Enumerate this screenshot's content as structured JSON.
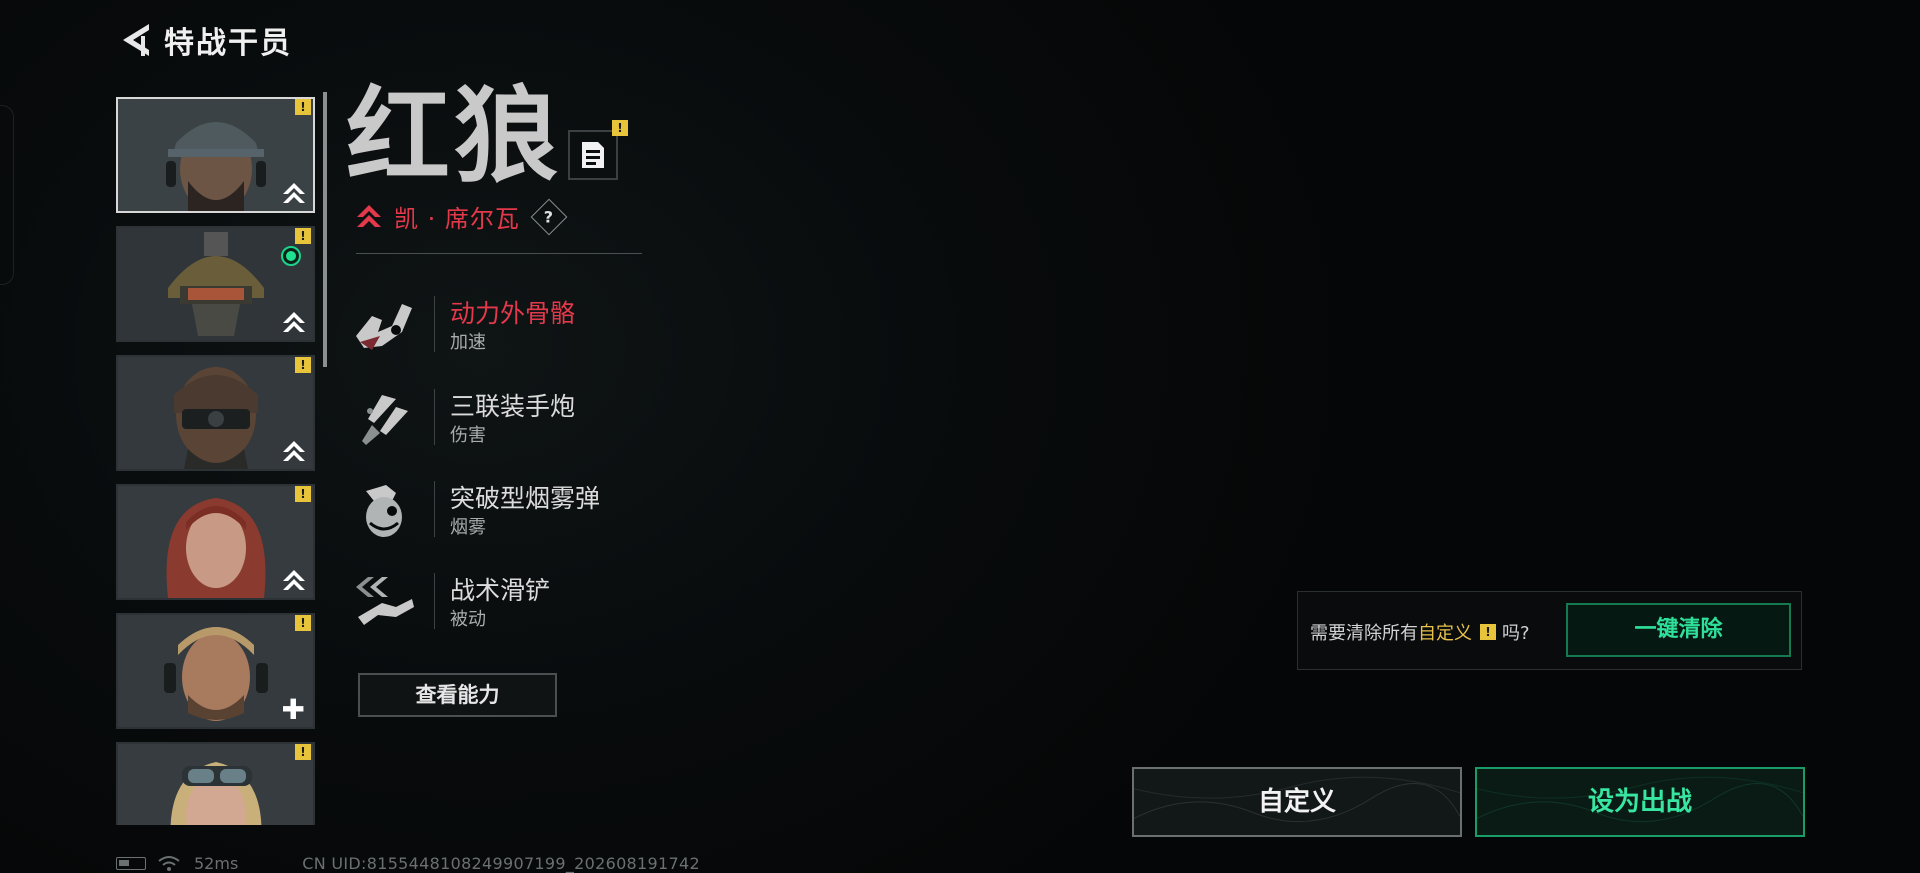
{
  "header": {
    "title": "特战干员"
  },
  "operators": [
    {
      "id": "op1",
      "selected": true,
      "alert": "!",
      "badge": "rank"
    },
    {
      "id": "op2",
      "selected": false,
      "alert": "!",
      "badge": "rank",
      "online": true
    },
    {
      "id": "op3",
      "selected": false,
      "alert": "!",
      "badge": "rank"
    },
    {
      "id": "op4",
      "selected": false,
      "alert": "!",
      "badge": "rank"
    },
    {
      "id": "op5",
      "selected": false,
      "alert": "!",
      "badge": "plus"
    },
    {
      "id": "op6",
      "selected": false,
      "alert": "!",
      "badge": "rank"
    }
  ],
  "detail": {
    "name": "红狼",
    "bio_alert": "!",
    "real_name": "凯 · 席尔瓦",
    "help": "?",
    "abilities": [
      {
        "title": "动力外骨骼",
        "type": "加速",
        "active": true
      },
      {
        "title": "三联装手炮",
        "type": "伤害"
      },
      {
        "title": "突破型烟雾弹",
        "type": "烟雾"
      },
      {
        "title": "战术滑铲",
        "type": "被动"
      }
    ],
    "view_ability_label": "查看能力"
  },
  "clear_panel": {
    "question_prefix": "需要清除所有",
    "question_highlight": "自定义",
    "warn": "!",
    "question_suffix": "吗?",
    "button_label": "一键清除"
  },
  "buttons": {
    "custom": "自定义",
    "deploy": "设为出战"
  },
  "footer": {
    "ping": "52ms",
    "uid": "CN UID:8155448108249907199_202608191742"
  },
  "colors": {
    "accent_red": "#e4394b",
    "accent_green": "#2ee09a",
    "alert_yellow": "#e7c43a"
  }
}
